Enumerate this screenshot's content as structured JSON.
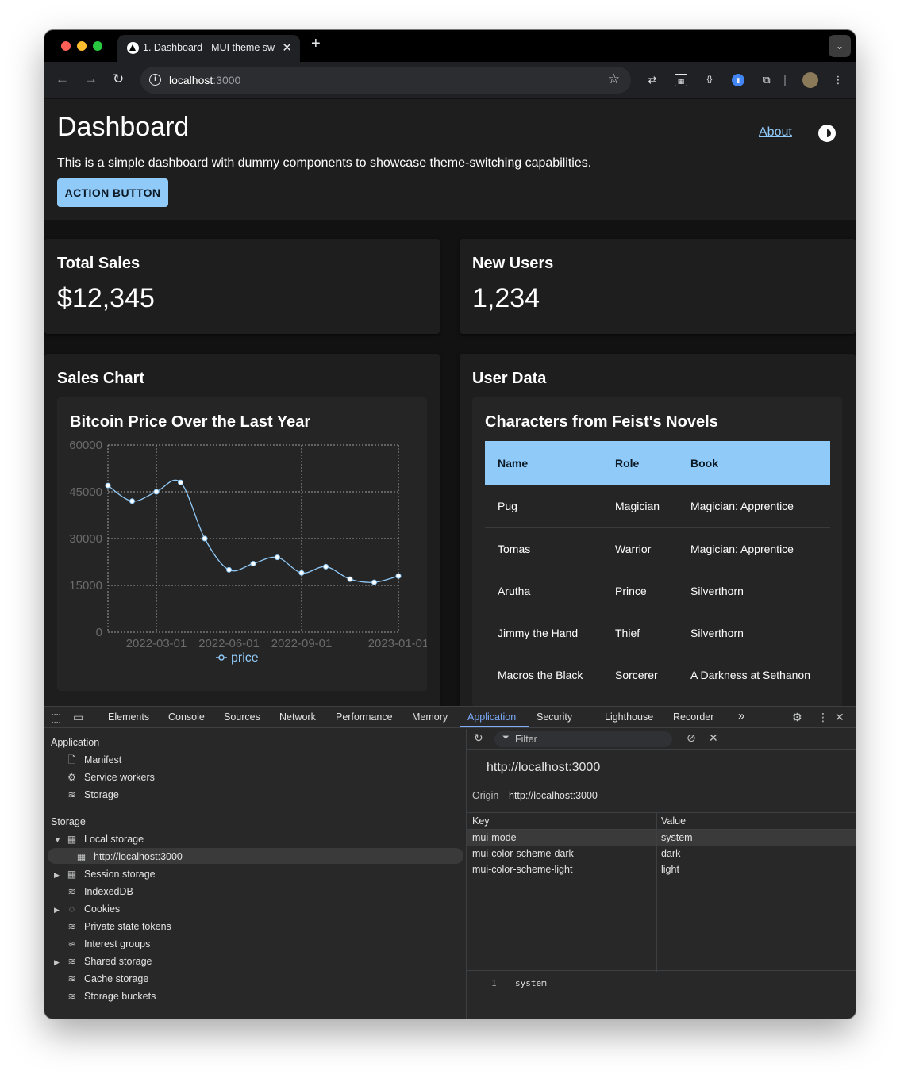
{
  "browser": {
    "tab_title": "1. Dashboard - MUI theme sw",
    "url_host": "localhost",
    "url_port": ":3000",
    "new_tab": "+",
    "close": "✕"
  },
  "header": {
    "title": "Dashboard",
    "about": "About",
    "description": "This is a simple dashboard with dummy components to showcase theme-switching capabilities.",
    "action_button": "ACTION BUTTON"
  },
  "cards": {
    "total_sales": {
      "label": "Total Sales",
      "value": "$12,345"
    },
    "new_users": {
      "label": "New Users",
      "value": "1,234"
    },
    "sales_chart": {
      "label": "Sales Chart"
    },
    "user_data": {
      "label": "User Data"
    }
  },
  "chart_data": {
    "type": "line",
    "title": "Bitcoin Price Over the Last Year",
    "series": [
      {
        "name": "price",
        "x": [
          "2022-01-01",
          "2022-02-01",
          "2022-03-01",
          "2022-04-01",
          "2022-05-01",
          "2022-06-01",
          "2022-07-01",
          "2022-08-01",
          "2022-09-01",
          "2022-10-01",
          "2022-11-01",
          "2022-12-01",
          "2023-01-01"
        ],
        "values": [
          47000,
          42000,
          45000,
          48000,
          30000,
          20000,
          22000,
          24000,
          19000,
          21000,
          17000,
          16000,
          18000
        ]
      }
    ],
    "xticks": [
      "2022-03-01",
      "2022-06-01",
      "2022-09-01",
      "2023-01-01"
    ],
    "yticks": [
      "0",
      "15000",
      "30000",
      "45000",
      "60000"
    ],
    "ylim": [
      0,
      60000
    ],
    "grid": true,
    "legend": "bottom",
    "color": "#90caf9"
  },
  "table": {
    "title": "Characters from Feist's Novels",
    "columns": [
      "Name",
      "Role",
      "Book"
    ],
    "rows": [
      [
        "Pug",
        "Magician",
        "Magician: Apprentice"
      ],
      [
        "Tomas",
        "Warrior",
        "Magician: Apprentice"
      ],
      [
        "Arutha",
        "Prince",
        "Silverthorn"
      ],
      [
        "Jimmy the Hand",
        "Thief",
        "Silverthorn"
      ],
      [
        "Macros the Black",
        "Sorcerer",
        "A Darkness at Sethanon"
      ]
    ]
  },
  "devtools": {
    "tabs": [
      "Elements",
      "Console",
      "Sources",
      "Network",
      "Performance",
      "Memory",
      "Application",
      "Security",
      "Lighthouse",
      "Recorder"
    ],
    "active_tab": "Application",
    "more": "»",
    "application_section": "Application",
    "application_items": [
      "Manifest",
      "Service workers",
      "Storage"
    ],
    "storage_section": "Storage",
    "storage_items": [
      "Local storage",
      "http://localhost:3000",
      "Session storage",
      "IndexedDB",
      "Cookies",
      "Private state tokens",
      "Interest groups",
      "Shared storage",
      "Cache storage",
      "Storage buckets"
    ],
    "filter_placeholder": "Filter",
    "origin_title": "http://localhost:3000",
    "origin_label": "Origin",
    "origin_value": "http://localhost:3000",
    "kv_headers": [
      "Key",
      "Value"
    ],
    "kv_rows": [
      [
        "mui-mode",
        "system"
      ],
      [
        "mui-color-scheme-dark",
        "dark"
      ],
      [
        "mui-color-scheme-light",
        "light"
      ]
    ],
    "preview_line": "1",
    "preview_value": "system"
  },
  "colors": {
    "accent": "#90caf9",
    "devtools_accent": "#7cacf8",
    "background": "#121212",
    "paper": "#1e1e1e"
  }
}
